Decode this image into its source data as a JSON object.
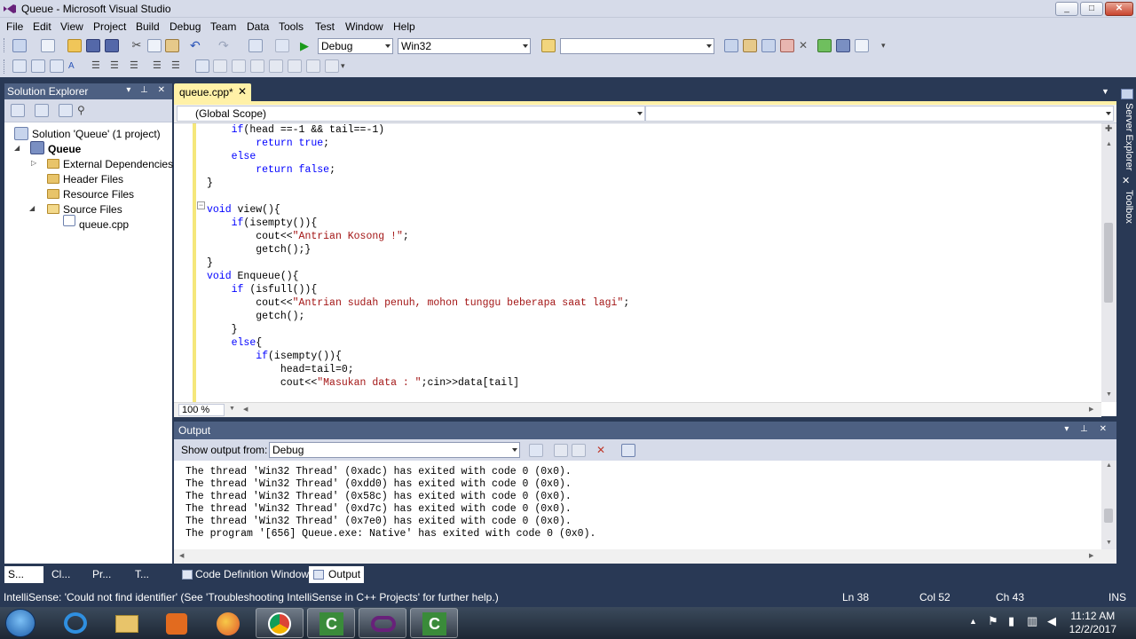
{
  "window": {
    "title": "Queue - Microsoft Visual Studio",
    "min": "_",
    "max": "□",
    "close": "✕"
  },
  "menu": [
    "File",
    "Edit",
    "View",
    "Project",
    "Build",
    "Debug",
    "Team",
    "Data",
    "Tools",
    "Test",
    "Window",
    "Help"
  ],
  "toolbar": {
    "config": "Debug",
    "platform": "Win32",
    "find": ""
  },
  "solution_explorer": {
    "title": "Solution Explorer",
    "header_buttons": "▾ ⊥ ✕",
    "solution": "Solution 'Queue' (1 project)",
    "project": "Queue",
    "nodes": [
      "External Dependencies",
      "Header Files",
      "Resource Files",
      "Source Files"
    ],
    "file": "queue.cpp"
  },
  "doc_tab": {
    "label": "queue.cpp*",
    "close": "✕"
  },
  "editor": {
    "scope": "(Global Scope)",
    "zoom": "100 %"
  },
  "code": [
    {
      "indent": "    ",
      "parts": [
        [
          "kw",
          "if"
        ],
        [
          "",
          "(head ==-1 && tail==-1)"
        ]
      ]
    },
    {
      "indent": "        ",
      "parts": [
        [
          "kw",
          "return"
        ],
        [
          "",
          " "
        ],
        [
          "kw",
          "true"
        ],
        [
          "",
          ";"
        ]
      ]
    },
    {
      "indent": "    ",
      "parts": [
        [
          "kw",
          "else"
        ]
      ]
    },
    {
      "indent": "        ",
      "parts": [
        [
          "kw",
          "return"
        ],
        [
          "",
          " "
        ],
        [
          "kw",
          "false"
        ],
        [
          "",
          ";"
        ]
      ]
    },
    {
      "indent": "",
      "parts": [
        [
          "",
          "}"
        ]
      ]
    },
    {
      "indent": "",
      "parts": [
        [
          "",
          ""
        ]
      ]
    },
    {
      "indent": "",
      "parts": [
        [
          "kw",
          "void"
        ],
        [
          "",
          " view(){"
        ]
      ]
    },
    {
      "indent": "    ",
      "parts": [
        [
          "kw",
          "if"
        ],
        [
          "",
          "(isempty()){"
        ]
      ]
    },
    {
      "indent": "        ",
      "parts": [
        [
          "",
          "cout<<"
        ],
        [
          "str",
          "\"Antrian Kosong !\""
        ],
        [
          "",
          ";"
        ]
      ]
    },
    {
      "indent": "        ",
      "parts": [
        [
          "",
          "getch();}"
        ]
      ]
    },
    {
      "indent": "",
      "parts": [
        [
          "",
          "}"
        ]
      ]
    },
    {
      "indent": "",
      "parts": [
        [
          "kw",
          "void"
        ],
        [
          "",
          " Enqueue(){"
        ]
      ]
    },
    {
      "indent": "    ",
      "parts": [
        [
          "kw",
          "if"
        ],
        [
          "",
          " (isfull()){"
        ]
      ]
    },
    {
      "indent": "        ",
      "parts": [
        [
          "",
          "cout<<"
        ],
        [
          "str",
          "\"Antrian sudah penuh, mohon tunggu beberapa saat lagi\""
        ],
        [
          "",
          ";"
        ]
      ]
    },
    {
      "indent": "        ",
      "parts": [
        [
          "",
          "getch();"
        ]
      ]
    },
    {
      "indent": "    ",
      "parts": [
        [
          "",
          "}"
        ]
      ]
    },
    {
      "indent": "    ",
      "parts": [
        [
          "kw",
          "else"
        ],
        [
          "",
          "{"
        ]
      ]
    },
    {
      "indent": "        ",
      "parts": [
        [
          "kw",
          "if"
        ],
        [
          "",
          "(isempty()){"
        ]
      ]
    },
    {
      "indent": "            ",
      "parts": [
        [
          "",
          "head=tail=0;"
        ]
      ]
    },
    {
      "indent": "            ",
      "parts": [
        [
          "",
          "cout<<"
        ],
        [
          "str",
          "\"Masukan data : \""
        ],
        [
          "",
          ";cin>>data[tail]"
        ]
      ]
    }
  ],
  "output": {
    "title": "Output",
    "header_buttons": "▾ ⊥ ✕",
    "show_from_label": "Show output from:",
    "source": "Debug",
    "lines": [
      "The thread 'Win32 Thread' (0xadc) has exited with code 0 (0x0).",
      "The thread 'Win32 Thread' (0xdd0) has exited with code 0 (0x0).",
      "The thread 'Win32 Thread' (0x58c) has exited with code 0 (0x0).",
      "The thread 'Win32 Thread' (0xd7c) has exited with code 0 (0x0).",
      "The thread 'Win32 Thread' (0x7e0) has exited with code 0 (0x0).",
      "The program '[656] Queue.exe: Native' has exited with code 0 (0x0)."
    ]
  },
  "bottom_tabs": {
    "left": [
      "S...",
      "Cl...",
      "Pr...",
      "T..."
    ],
    "code_def": "Code Definition Window",
    "output": "Output"
  },
  "side_tabs": {
    "server": "Server Explorer",
    "toolbox": "Toolbox"
  },
  "status": {
    "message": "IntelliSense: 'Could not find identifier' (See 'Troubleshooting IntelliSense in C++ Projects' for further help.)",
    "ln": "Ln 38",
    "col": "Col 52",
    "ch": "Ch 43",
    "mode": "INS"
  },
  "clock": {
    "time": "11:12 AM",
    "date": "12/2/2017"
  },
  "colors": {
    "accent": "#293955",
    "tab_active": "#fff1a7",
    "keyword": "#0000ff",
    "string": "#a31515"
  }
}
